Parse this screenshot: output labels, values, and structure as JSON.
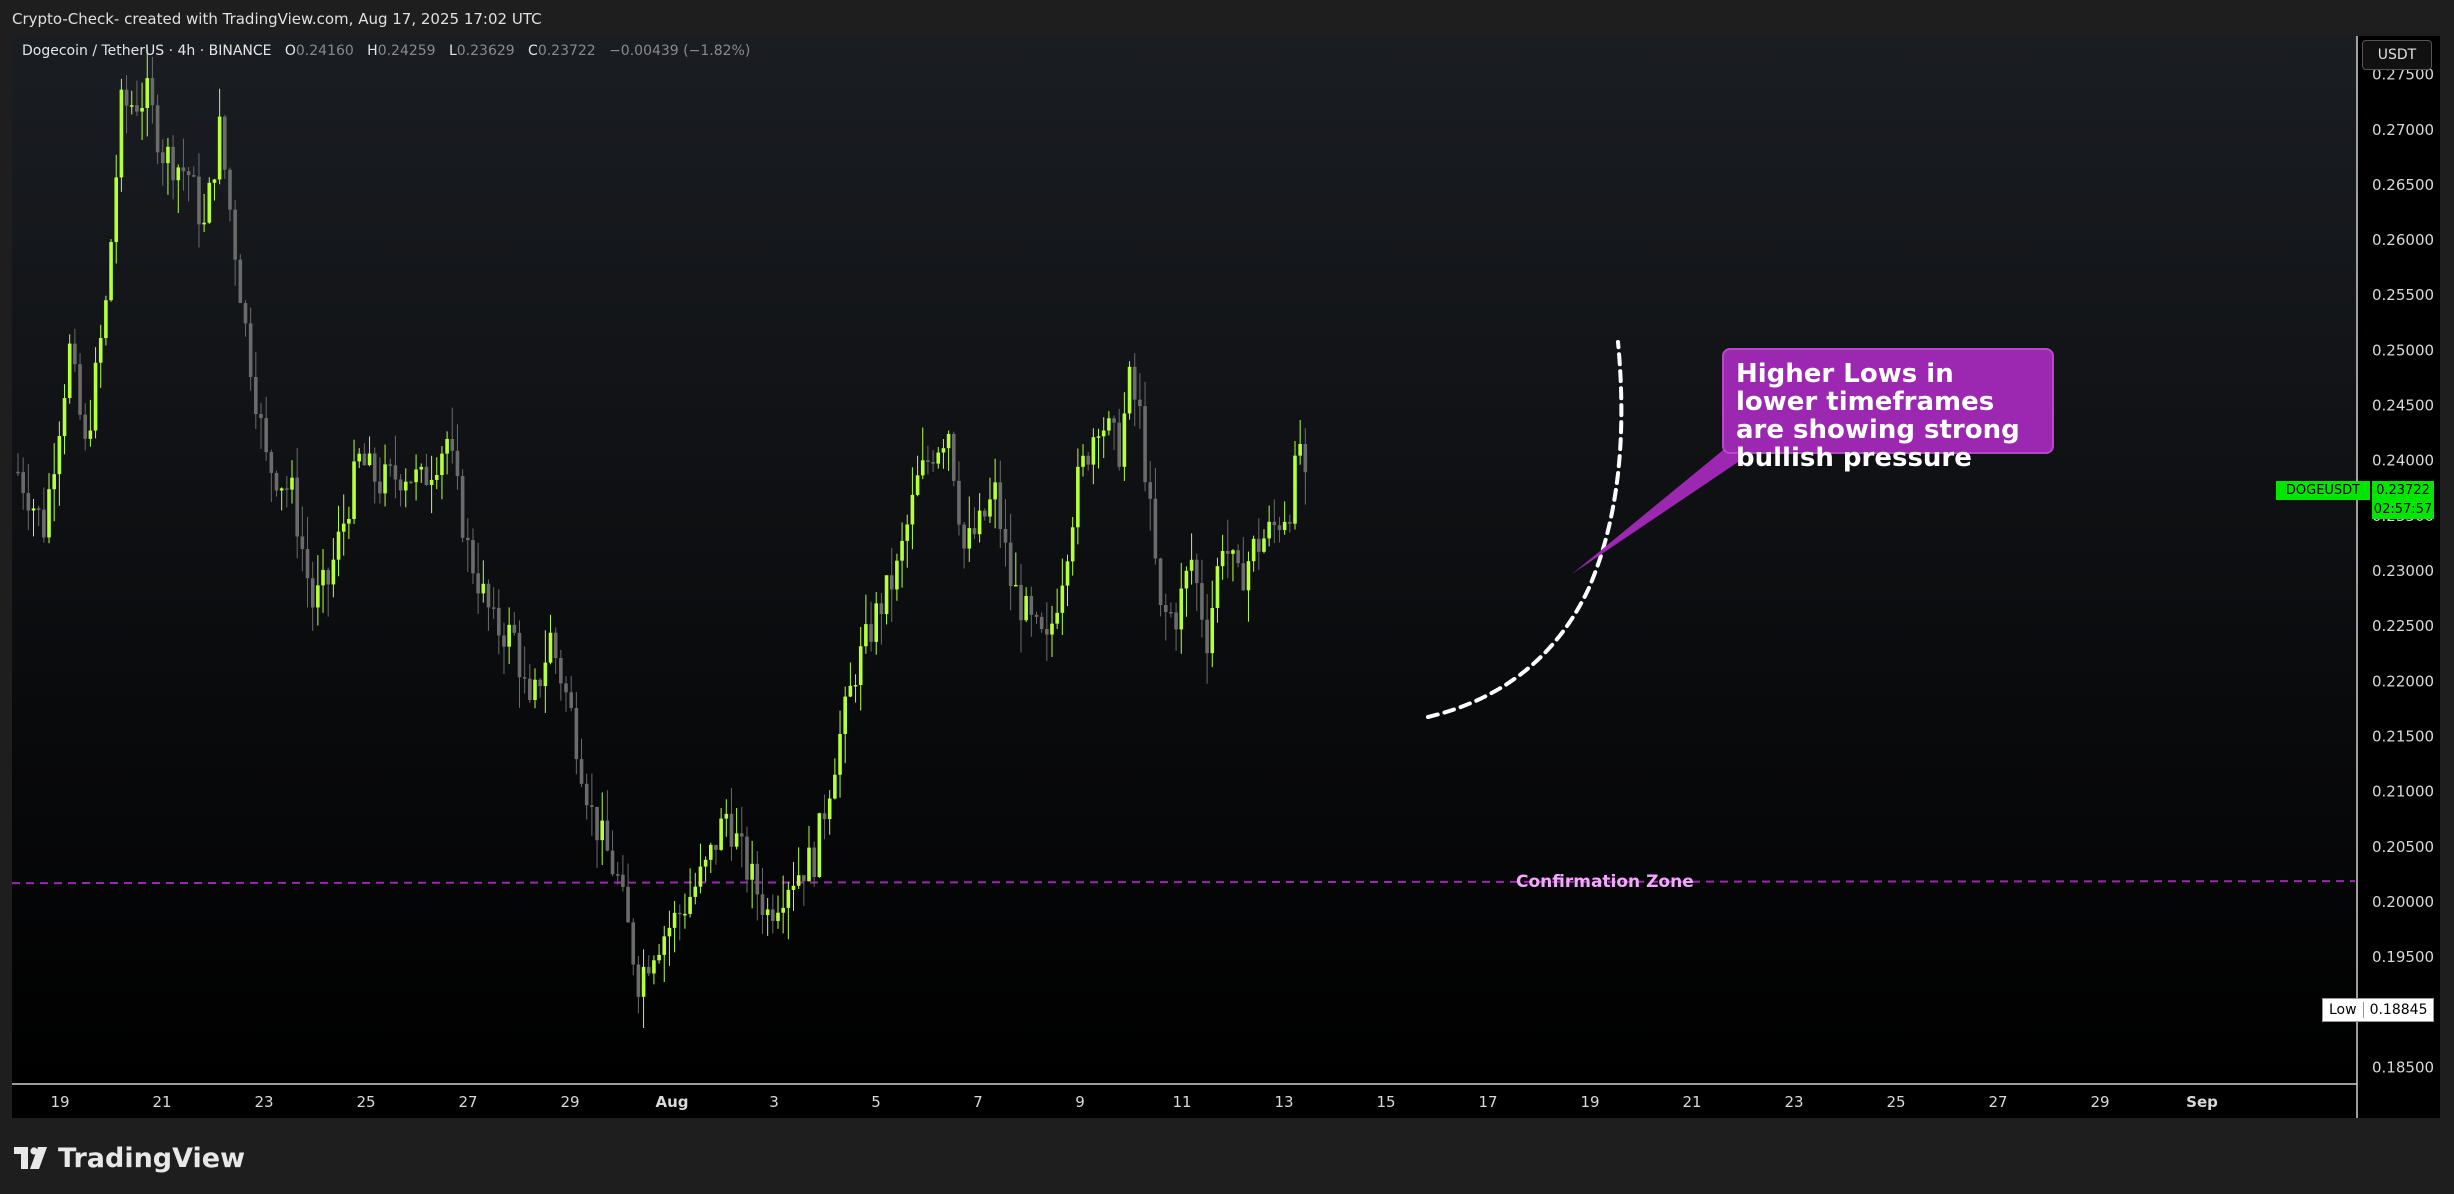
{
  "header": {
    "caption": "Crypto-Check- created with TradingView.com, Aug 17, 2025 17:02 UTC"
  },
  "legend": {
    "symbol": "Dogecoin / TetherUS · 4h · BINANCE",
    "o_label": "O",
    "o_value": "0.24160",
    "h_label": "H",
    "h_value": "0.24259",
    "l_label": "L",
    "l_value": "0.23629",
    "c_label": "C",
    "c_value": "0.23722",
    "change": "−0.00439 (−1.82%)"
  },
  "currency_button": "USDT",
  "annotations": {
    "callout": "Higher Lows in lower timeframes are showing strong bullish pressure",
    "zone_label": "Confirmation Zone"
  },
  "price_tag": {
    "ticker": "DOGEUSDT",
    "price": "0.23722",
    "countdown": "02:57:57"
  },
  "low_tag": {
    "label": "Low",
    "value": "0.18845"
  },
  "footer": {
    "brand": "TradingView"
  },
  "colors": {
    "up": "#b6ff3b",
    "down": "#6b6b6b",
    "background": "#000000",
    "zone": "#9c27b0",
    "callout": "#9c27b0"
  },
  "chart_data": {
    "type": "candlestick",
    "timeframe": "4h",
    "price_ticks": [
      "0.27500",
      "0.27000",
      "0.26500",
      "0.26000",
      "0.25500",
      "0.25000",
      "0.24500",
      "0.24000",
      "0.23500",
      "0.23000",
      "0.22500",
      "0.22000",
      "0.21500",
      "0.21000",
      "0.20500",
      "0.20000",
      "0.19500",
      "0.19000",
      "0.18500"
    ],
    "ylim": [
      0.1835,
      0.2785
    ],
    "x_ticks": [
      "19",
      "21",
      "23",
      "25",
      "27",
      "29",
      "Aug",
      "3",
      "5",
      "7",
      "9",
      "11",
      "13",
      "15",
      "17",
      "19",
      "21",
      "23",
      "25",
      "27",
      "29",
      "Sep"
    ],
    "confirmation_zone_price": 0.2018,
    "last_price": 0.23722,
    "low_price": 0.18845,
    "waypoints": [
      [
        0,
        0.239
      ],
      [
        5,
        0.234
      ],
      [
        10,
        0.25
      ],
      [
        13,
        0.241
      ],
      [
        17,
        0.254
      ],
      [
        20,
        0.272
      ],
      [
        25,
        0.273
      ],
      [
        28,
        0.268
      ],
      [
        33,
        0.266
      ],
      [
        36,
        0.261
      ],
      [
        39,
        0.27
      ],
      [
        44,
        0.252
      ],
      [
        48,
        0.24
      ],
      [
        53,
        0.237
      ],
      [
        57,
        0.227
      ],
      [
        60,
        0.229
      ],
      [
        66,
        0.24
      ],
      [
        70,
        0.238
      ],
      [
        75,
        0.239
      ],
      [
        78,
        0.238
      ],
      [
        83,
        0.242
      ],
      [
        87,
        0.232
      ],
      [
        92,
        0.225
      ],
      [
        96,
        0.224
      ],
      [
        99,
        0.217
      ],
      [
        103,
        0.224
      ],
      [
        107,
        0.217
      ],
      [
        111,
        0.208
      ],
      [
        116,
        0.202
      ],
      [
        120,
        0.193
      ],
      [
        123,
        0.196
      ],
      [
        128,
        0.199
      ],
      [
        133,
        0.203
      ],
      [
        137,
        0.208
      ],
      [
        141,
        0.203
      ],
      [
        145,
        0.199
      ],
      [
        149,
        0.202
      ],
      [
        154,
        0.204
      ],
      [
        158,
        0.213
      ],
      [
        162,
        0.221
      ],
      [
        166,
        0.226
      ],
      [
        170,
        0.23
      ],
      [
        174,
        0.238
      ],
      [
        177,
        0.241
      ],
      [
        180,
        0.243
      ],
      [
        183,
        0.232
      ],
      [
        186,
        0.234
      ],
      [
        189,
        0.237
      ],
      [
        192,
        0.229
      ],
      [
        196,
        0.225
      ],
      [
        199,
        0.223
      ],
      [
        202,
        0.23
      ],
      [
        205,
        0.238
      ],
      [
        209,
        0.244
      ],
      [
        213,
        0.241
      ],
      [
        215,
        0.247
      ],
      [
        217,
        0.244
      ],
      [
        221,
        0.226
      ],
      [
        224,
        0.226
      ],
      [
        227,
        0.231
      ],
      [
        230,
        0.224
      ],
      [
        233,
        0.233
      ],
      [
        236,
        0.229
      ],
      [
        239,
        0.232
      ],
      [
        243,
        0.234
      ],
      [
        246,
        0.236
      ],
      [
        248,
        0.2416
      ],
      [
        249,
        0.2372
      ]
    ],
    "n_candles": 250
  }
}
